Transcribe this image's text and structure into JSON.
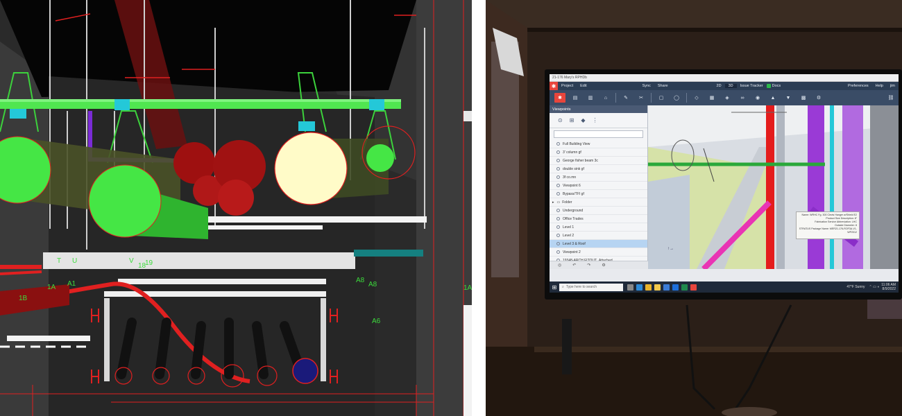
{
  "left_panel": {
    "labels": [
      "T",
      "U",
      "V",
      "18",
      "19",
      "1A",
      "A1",
      "1B",
      "A8",
      "A8",
      "A6",
      "1A"
    ]
  },
  "right_panel": {
    "app": {
      "title": "21-176 Mary's RPHDb",
      "menu": [
        "Project",
        "Edit",
        "Sync",
        "Share",
        "2D",
        "3D",
        "Issue Tracker",
        "Docs",
        "Preferences",
        "Help",
        "jim"
      ],
      "toolbar_icons": [
        "logo-icon",
        "layers-icon",
        "book-icon",
        "home-icon",
        "pencil-icon",
        "scissors-icon",
        "comment-icon",
        "bt-icon",
        "paint-bucket-icon",
        "layout-icon",
        "cube-icon",
        "binoculars-icon",
        "eye-icon",
        "paint-icon",
        "filter-icon",
        "link-icon"
      ],
      "viewpoints": {
        "header": "Viewpoints",
        "items": [
          "Full Building View",
          "3' column gf",
          "George fisher beam 3c",
          "double sink gf",
          "3f co.mn",
          "Viewpoint 6",
          "Bypass/TFI gf",
          "Folder",
          "Underground",
          "Office Trades",
          "Level 1",
          "Level 2",
          "Level 3 & Roof",
          "Viewpoint 2",
          "19348-ARCH FITOUT_Attached"
        ],
        "selected_index": 12
      },
      "tooltip": {
        "lines": [
          "Name: WRHC Fg. 300 Clevis Hanger w/Shield E2",
          "Product Size Description: 8\"",
          "Fabrication Service Abbreviation: LHC",
          "Outside Diameter: 8",
          "STRATUS Package Name: MER21-176-ROF3A-V1-WP2012"
        ]
      },
      "taskbar": {
        "search_placeholder": "Type here to search",
        "weather": "47°F Sunny",
        "time": "11:06 AM",
        "date": "8/9/2022"
      }
    }
  }
}
